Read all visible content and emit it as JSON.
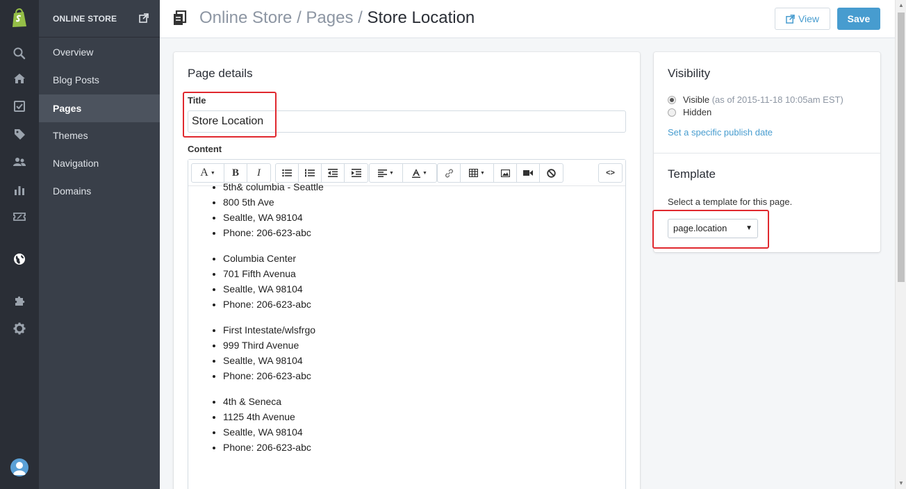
{
  "sidebar": {
    "icons": [
      "shopify-logo-icon",
      "search-icon",
      "home-icon",
      "orders-icon",
      "tag-icon",
      "customers-icon",
      "reports-icon",
      "discounts-icon",
      "globe-icon",
      "puzzle-icon",
      "gear-icon",
      "user-avatar-icon"
    ]
  },
  "subnav": {
    "header": "ONLINE STORE",
    "items": [
      {
        "label": "Overview",
        "active": false
      },
      {
        "label": "Blog Posts",
        "active": false
      },
      {
        "label": "Pages",
        "active": true
      },
      {
        "label": "Themes",
        "active": false
      },
      {
        "label": "Navigation",
        "active": false
      },
      {
        "label": "Domains",
        "active": false
      }
    ]
  },
  "header": {
    "crumb1": "Online Store",
    "sep": " / ",
    "crumb2": "Pages",
    "current": "Store Location",
    "view_label": "View",
    "save_label": "Save"
  },
  "page_details": {
    "heading": "Page details",
    "title_label": "Title",
    "title_value": "Store Location",
    "content_label": "Content",
    "toolbar": {
      "font": "A",
      "bold": "B",
      "italic": "I",
      "code": "<>"
    },
    "content_lists": [
      [
        "5th& columbia - Seattle",
        "800 5th Ave",
        "Sealtle, WA 98104",
        "Phone: 206-623-abc"
      ],
      [
        "Columbia Center",
        "701 Fifth Avenua",
        "Sealtle, WA 98104",
        "Phone: 206-623-abc"
      ],
      [
        "First Intestate/wlsfrgo",
        "999 Third Avenue",
        "Sealtle, WA 98104",
        "Phone: 206-623-abc"
      ],
      [
        "4th & Seneca",
        "1125 4th Avenue",
        "Sealtle, WA 98104",
        "Phone: 206-623-abc"
      ]
    ]
  },
  "visibility": {
    "heading": "Visibility",
    "visible_label": "Visible",
    "visible_note": "(as of 2015-11-18 10:05am EST)",
    "hidden_label": "Hidden",
    "selected": "visible",
    "publish_link": "Set a specific publish date"
  },
  "template": {
    "heading": "Template",
    "description": "Select a template for this page.",
    "selected": "page.location"
  },
  "colors": {
    "accent": "#479ccf",
    "highlight_box": "#e0282e",
    "sidebar_dark": "#2a2e36",
    "subnav_bg": "#393f49"
  }
}
